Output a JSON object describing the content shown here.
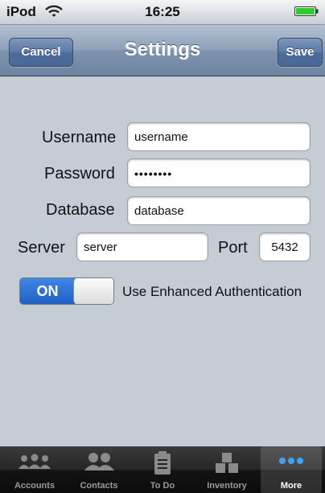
{
  "status_bar": {
    "carrier": "iPod",
    "time": "16:25"
  },
  "nav": {
    "title": "Settings",
    "cancel_label": "Cancel",
    "save_label": "Save"
  },
  "form": {
    "username_label": "Username",
    "username_value": "username",
    "password_label": "Password",
    "password_value": "••••••••",
    "database_label": "Database",
    "database_value": "database",
    "server_label": "Server",
    "server_value": "server",
    "port_label": "Port",
    "port_value": "5432"
  },
  "auth_switch": {
    "state_label": "ON",
    "label": "Use Enhanced Authentication"
  },
  "tab_bar": {
    "tabs": [
      {
        "label": "Accounts",
        "icon": "accounts-icon"
      },
      {
        "label": "Contacts",
        "icon": "contacts-icon"
      },
      {
        "label": "To Do",
        "icon": "todo-icon"
      },
      {
        "label": "Inventory",
        "icon": "inventory-icon"
      },
      {
        "label": "More",
        "icon": "more-icon"
      }
    ],
    "active_tab": "More"
  },
  "colors": {
    "nav_bar": "#7f93ae",
    "switch_on": "#2e72d8",
    "background": "#c5ccd4"
  }
}
